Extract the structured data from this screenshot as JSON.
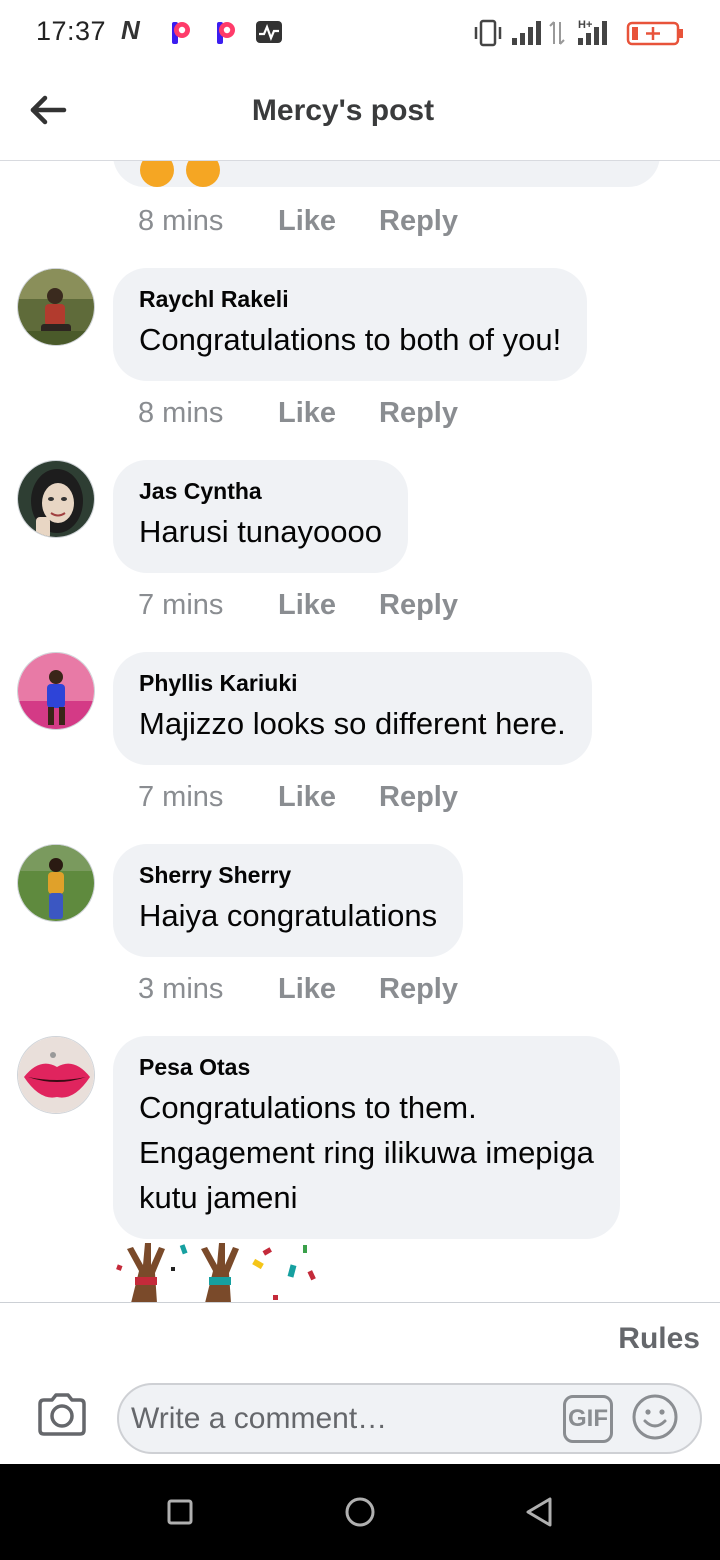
{
  "status_bar": {
    "time": "17:37",
    "icons": [
      "n-notification-icon",
      "p-app-icon",
      "p-app-icon",
      "activity-icon",
      "vibrate-icon",
      "signal-icon",
      "data-transfer-icon",
      "h-plus-signal-icon",
      "battery-low-icon"
    ],
    "network_label": "H+"
  },
  "header": {
    "title": "Mercy's post",
    "back_icon": "arrow-left-icon"
  },
  "previous_comment": {
    "time": "8 mins",
    "like": "Like",
    "reply": "Reply"
  },
  "comments": [
    {
      "author": "Raychl Rakeli",
      "lines": [
        "Congratulations to both of you!"
      ],
      "time": "8 mins",
      "like": "Like",
      "reply": "Reply"
    },
    {
      "author": "Jas Cyntha",
      "lines": [
        "Harusi tunayoooo"
      ],
      "time": "7 mins",
      "like": "Like",
      "reply": "Reply"
    },
    {
      "author": "Phyllis Kariuki",
      "lines": [
        "Majizzo looks so different here."
      ],
      "time": "7 mins",
      "like": "Like",
      "reply": "Reply"
    },
    {
      "author": "Sherry Sherry",
      "lines": [
        "Haiya congratulations"
      ],
      "time": "3 mins",
      "like": "Like",
      "reply": "Reply"
    },
    {
      "author": "Pesa Otas",
      "lines": [
        "Congratulations to them.",
        "Engagement ring ilikuwa imepiga",
        "kutu jameni"
      ]
    }
  ],
  "composer": {
    "rules": "Rules",
    "placeholder": "Write a comment…",
    "gif": "GIF",
    "camera_icon": "camera-icon",
    "emoji_icon": "smiley-icon"
  },
  "nav": {
    "icons": [
      "recents-square-icon",
      "home-circle-icon",
      "back-triangle-icon"
    ]
  },
  "colors": {
    "bubble": "#f0f2f5",
    "meta": "#8a8d91",
    "title": "#3a3b3c",
    "battery": "#e8533a"
  }
}
